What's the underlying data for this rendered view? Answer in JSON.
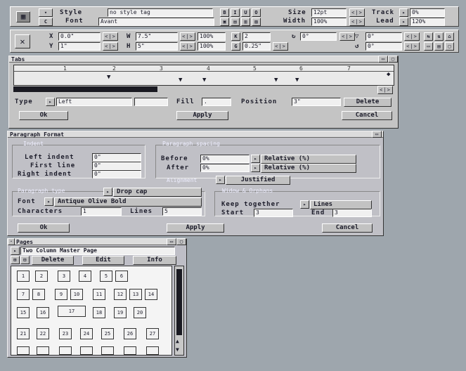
{
  "style_bar": {
    "style_label": "Style",
    "style_value": "no style tag",
    "font_label": "Font",
    "font_value": "Avant",
    "bold_btn": "B",
    "italic_btn": "I",
    "underline_btn": "U",
    "outline_btn": "O",
    "size_label": "Size",
    "size_value": "12pt",
    "width_label": "Width",
    "width_value": "100%",
    "track_label": "Track",
    "track_value": "0%",
    "lead_label": "Lead",
    "lead_value": "120%",
    "updown": "<|>"
  },
  "obj_bar": {
    "x_label": "X",
    "x_value": "0.0\"",
    "y_label": "Y",
    "y_value": "1\"",
    "w_label": "W",
    "w_value": "7.5\"",
    "h_label": "H",
    "h_value": "5\"",
    "pct1": "100%",
    "pct2": "100%",
    "k_value": "2",
    "g_value": "0.25\"",
    "angle_value": "0°",
    "r1_value": "0°",
    "r2_value": "0°",
    "updown": "<|>"
  },
  "tabs": {
    "title": "Tabs",
    "ruler_nums": [
      "1",
      "2",
      "3",
      "4",
      "5",
      "6",
      "7"
    ],
    "type_label": "Type",
    "type_value": "Left",
    "fill_label": "Fill",
    "fill_value": ".",
    "position_label": "Position",
    "position_value": "3\"",
    "delete_btn": "Delete",
    "ok_btn": "Ok",
    "apply_btn": "Apply",
    "cancel_btn": "Cancel",
    "updown": "<|>"
  },
  "para": {
    "title": "Paragraph Format",
    "indent_section": "Indent",
    "spacing_section": "Paragraph spacing",
    "left_indent_label": "Left indent",
    "left_indent_value": "0\"",
    "first_line_label": "First line",
    "first_line_value": "0\"",
    "right_indent_label": "Right indent",
    "right_indent_value": "0\"",
    "before_label": "Before",
    "before_value": "0%",
    "before_mode": "Relative (%)",
    "after_label": "After",
    "after_value": "0%",
    "after_mode": "Relative (%)",
    "alignment_label": "Alignment",
    "alignment_value": "Justified",
    "para_type_section": "Paragraph type",
    "para_type_value": "Drop cap",
    "widow_section": "Widow & Orphans",
    "font_label": "Font",
    "font_value": "Antique Olive Bold",
    "keep_label": "Keep together",
    "keep_value": "Lines",
    "characters_label": "Characters",
    "characters_value": "1",
    "lines_label": "Lines",
    "lines_value": "5",
    "start_label": "Start",
    "start_value": "3",
    "end_label": "End",
    "end_value": "3",
    "ok_btn": "Ok",
    "apply_btn": "Apply",
    "cancel_btn": "Cancel"
  },
  "pages": {
    "title": "Pages",
    "master_value": "Two Column Master Page",
    "delete_btn": "Delete",
    "edit_btn": "Edit",
    "info_btn": "Info",
    "rows": [
      [
        "1",
        "2",
        "3",
        "4",
        "5",
        "6"
      ],
      [
        "7",
        "8",
        "9",
        "10",
        "11",
        "12",
        "13",
        "14"
      ],
      [
        "15",
        "16",
        "17",
        "18",
        "19",
        "20"
      ],
      [
        "21",
        "22",
        "23",
        "24",
        "25",
        "26",
        "27"
      ]
    ]
  },
  "colors": {
    "desktop": "#9ea6ad",
    "window": "#c4c4c4",
    "field": "#f0f0f0",
    "text": "#1c1c2a"
  }
}
